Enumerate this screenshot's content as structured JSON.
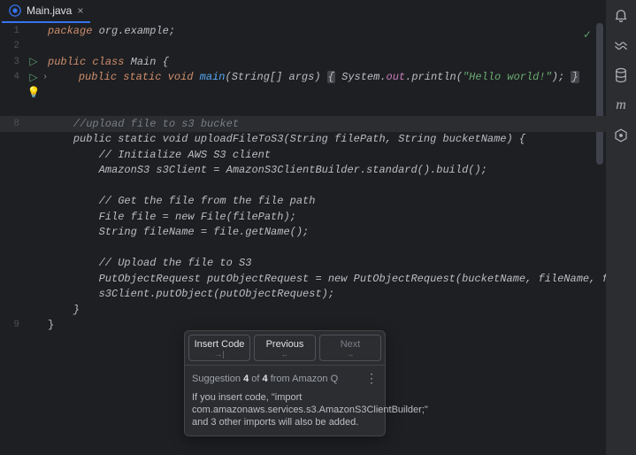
{
  "tab": {
    "filename": "Main.java"
  },
  "gutter_lines": [
    "1",
    "2",
    "3",
    "4",
    "",
    "",
    "",
    "8",
    "",
    "",
    "",
    "",
    "",
    "",
    "",
    "",
    "",
    "",
    "",
    "9"
  ],
  "code": {
    "l1_package": "package",
    "l1_pkg": " org.example;",
    "l3_public": "public",
    "l3_class": " class",
    "l3_name": " Main {",
    "l4_pad": "    ",
    "l4_public": "public",
    "l4_static": " static",
    "l4_void": " void",
    "l4_main": " main",
    "l4_args": "(String[] args) ",
    "l4_lb": "{",
    "l4_sys": " System.",
    "l4_out": "out",
    "l4_print": ".println(",
    "l4_str": "\"Hello world!\"",
    "l4_end": "); ",
    "l4_rb": "}",
    "l8_comment": "    //upload file to s3 bucket",
    "l9_pad": "    ",
    "l9_kw": "public static void",
    "l9_rest": " uploadFileToS3(String filePath, String bucketName) {",
    "l10": "        // Initialize AWS S3 client",
    "l11": "        AmazonS3 s3Client = AmazonS3ClientBuilder.standard().build();",
    "l13": "        // Get the file from the file path",
    "l14": "        File file = new File(filePath);",
    "l15": "        String fileName = file.getName();",
    "l17": "        // Upload the file to S3",
    "l18": "        PutObjectRequest putObjectRequest = new PutObjectRequest(bucketName, fileName, file);",
    "l19": "        s3Client.putObject(putObjectRequest);",
    "l20": "    }",
    "close_brace": "}"
  },
  "popup": {
    "insert": "Insert Code",
    "insert_hint": "→|",
    "prev": "Previous",
    "prev_hint": "←",
    "next": "Next",
    "next_hint": "→",
    "suggestion_prefix": "Suggestion ",
    "suggestion_n": "4",
    "suggestion_of": " of ",
    "suggestion_total": "4",
    "suggestion_from": " from Amazon Q",
    "body": "If you insert code, \"import com.amazonaws.services.s3.AmazonS3ClientBuilder;\" and 3 other imports will also be added."
  },
  "tool_icons": {
    "bell": "bell-icon",
    "wave": "wave-icon",
    "db": "database-icon",
    "m": "m-icon",
    "hex": "hex-icon"
  }
}
